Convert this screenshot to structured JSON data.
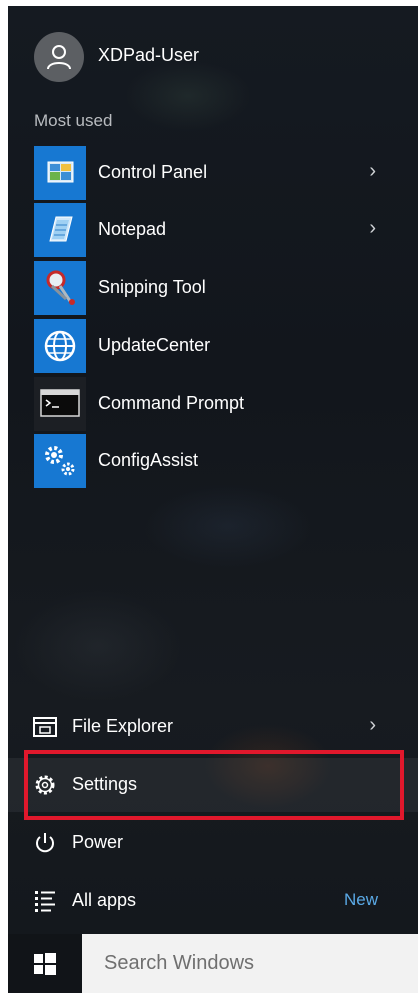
{
  "user": {
    "name": "XDPad-User",
    "avatar_icon": "person-icon"
  },
  "most_used": {
    "label": "Most used",
    "items": [
      {
        "label": "Control Panel",
        "icon": "control-panel-icon",
        "has_submenu": true
      },
      {
        "label": "Notepad",
        "icon": "notepad-icon",
        "has_submenu": true
      },
      {
        "label": "Snipping Tool",
        "icon": "snipping-tool-icon",
        "has_submenu": false
      },
      {
        "label": "UpdateCenter",
        "icon": "globe-icon",
        "has_submenu": false
      },
      {
        "label": "Command Prompt",
        "icon": "command-prompt-icon",
        "has_submenu": false
      },
      {
        "label": "ConfigAssist",
        "icon": "gears-icon",
        "has_submenu": false
      }
    ]
  },
  "bottom": {
    "file_explorer": {
      "label": "File Explorer",
      "icon": "folder-icon",
      "has_submenu": true
    },
    "settings": {
      "label": "Settings",
      "icon": "gear-icon",
      "highlighted": true
    },
    "power": {
      "label": "Power",
      "icon": "power-icon"
    },
    "all_apps": {
      "label": "All apps",
      "icon": "list-icon",
      "badge": "New"
    }
  },
  "taskbar": {
    "start_icon": "windows-logo-icon",
    "search_placeholder": "Search Windows"
  },
  "colors": {
    "tile_blue": "#1778d2",
    "highlight_red": "#e1182c",
    "badge_blue": "#5aa9e6"
  }
}
